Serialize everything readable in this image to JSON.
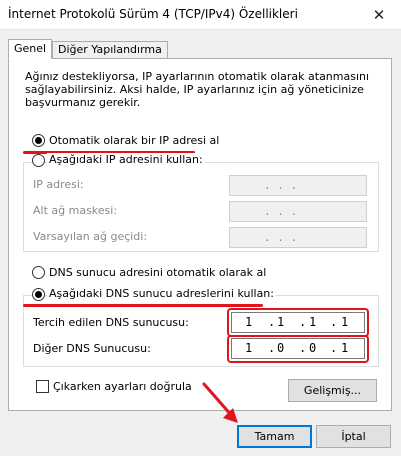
{
  "window": {
    "title": "İnternet Protokolü Sürüm 4 (TCP/IPv4) Özellikleri",
    "close_glyph": "✕"
  },
  "tabs": [
    {
      "label": "Genel",
      "active": true
    },
    {
      "label": "Diğer Yapılandırma",
      "active": false
    }
  ],
  "intro_text": "Ağınız destekliyorsa, IP ayarlarının otomatik olarak atanmasını sağlayabilirsiniz. Aksi halde, IP ayarlarınız için ağ yöneticinize başvurmanız gerekir.",
  "ip_section": {
    "auto_label": "Otomatik olarak bir IP adresi al",
    "auto_selected": true,
    "manual_label": "Aşağıdaki IP adresini kullan:",
    "manual_selected": false,
    "fields": [
      {
        "label": "IP adresi:",
        "value": ". . ."
      },
      {
        "label": "Alt ağ maskesi:",
        "value": ". . ."
      },
      {
        "label": "Varsayılan ağ geçidi:",
        "value": ". . ."
      }
    ]
  },
  "dns_section": {
    "auto_label": "DNS sunucu adresini otomatik olarak al",
    "auto_selected": false,
    "manual_label": "Aşağıdaki DNS sunucu adreslerini kullan:",
    "manual_selected": true,
    "preferred": {
      "label": "Tercih edilen DNS sunucusu:",
      "octets": [
        "1",
        "1",
        "1",
        "1"
      ]
    },
    "alternate": {
      "label": "Diğer DNS Sunucusu:",
      "octets": [
        "1",
        "0",
        "0",
        "1"
      ]
    }
  },
  "validate": {
    "label": "Çıkarken ayarları doğrula",
    "checked": false
  },
  "buttons": {
    "advanced": "Gelişmiş...",
    "ok": "Tamam",
    "cancel": "İptal"
  },
  "colors": {
    "highlight": "#e0141d",
    "focus": "#0078d7"
  }
}
